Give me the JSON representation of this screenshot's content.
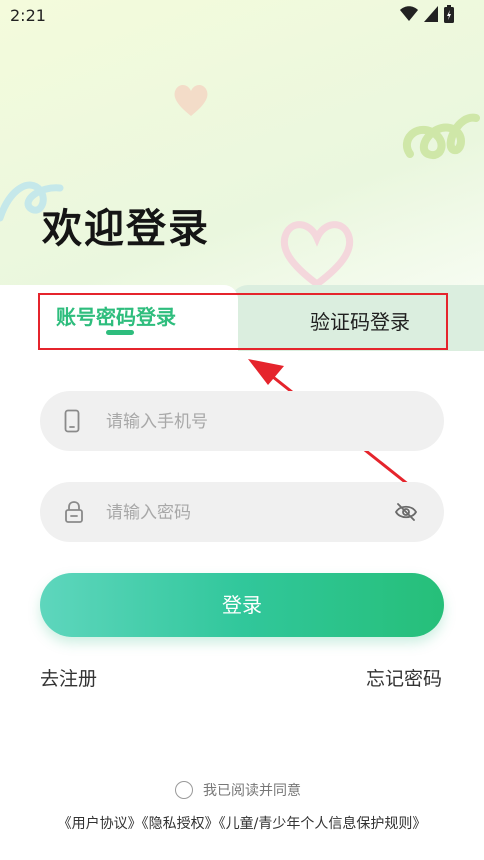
{
  "status_bar": {
    "time": "2:21"
  },
  "welcome_title": "欢迎登录",
  "tabs": {
    "password_login": "账号密码登录",
    "code_login": "验证码登录"
  },
  "fields": {
    "phone_placeholder": "请输入手机号",
    "password_placeholder": "请输入密码"
  },
  "login_button": "登录",
  "links": {
    "register": "去注册",
    "forgot_password": "忘记密码"
  },
  "agreement": {
    "text": "我已阅读并同意",
    "policies": "《用户协议》《隐私授权》《儿童/青少年个人信息保护规则》"
  },
  "colors": {
    "accent": "#2ebd7d",
    "highlight": "#e5242c",
    "inactive_tab": "#dbeedf"
  }
}
